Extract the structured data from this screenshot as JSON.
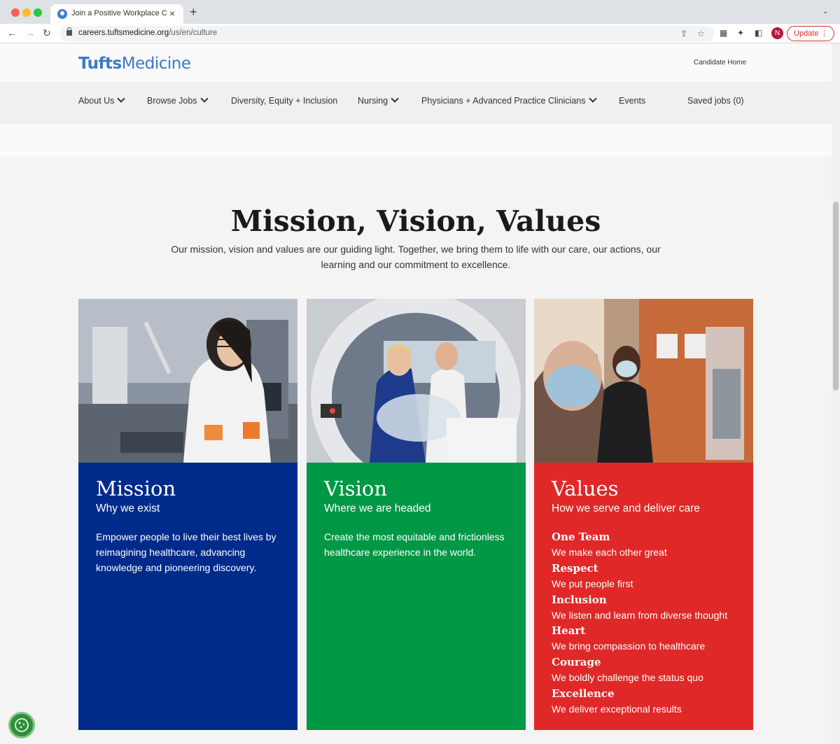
{
  "browser": {
    "tab_title": "Join a Positive Workplace Culture",
    "url_domain": "careers.tuftsmedicine.org",
    "url_path": "/us/en/culture",
    "profile_initial": "N",
    "update_label": "Update"
  },
  "site": {
    "logo_bold": "Tufts",
    "logo_light": "Medicine",
    "candidate_home": "Candidate Home",
    "nav": {
      "about": "About Us",
      "browse": "Browse Jobs",
      "dei": "Diversity, Equity + Inclusion",
      "nursing": "Nursing",
      "physicians": "Physicians + Advanced Practice Clinicians",
      "events": "Events",
      "saved": "Saved jobs (0)"
    }
  },
  "section": {
    "title": "Mission, Vision, Values",
    "subtitle": "Our mission, vision and values are our guiding light. Together, we bring them to life with our care, our actions, our learning and our commitment to excellence."
  },
  "cards": {
    "mission": {
      "heading": "Mission",
      "tagline": "Why we exist",
      "text": "Empower people to live their best lives by reimagining healthcare, advancing knowledge and pioneering discovery.",
      "color": "#002b8a"
    },
    "vision": {
      "heading": "Vision",
      "tagline": "Where we are headed",
      "text": "Create the most equitable and frictionless healthcare experience in the world.",
      "color": "#009845"
    },
    "values": {
      "heading": "Values",
      "tagline": "How we serve and deliver care",
      "color": "#e02828",
      "items": [
        {
          "name": "One Team",
          "desc": "We make each other great"
        },
        {
          "name": "Respect",
          "desc": "We put people first"
        },
        {
          "name": "Inclusion",
          "desc": "We listen and learn from diverse thought"
        },
        {
          "name": "Heart",
          "desc": "We bring compassion to healthcare"
        },
        {
          "name": "Courage",
          "desc": "We boldly challenge the status quo"
        },
        {
          "name": "Excellence",
          "desc": "We deliver exceptional results"
        }
      ]
    }
  }
}
